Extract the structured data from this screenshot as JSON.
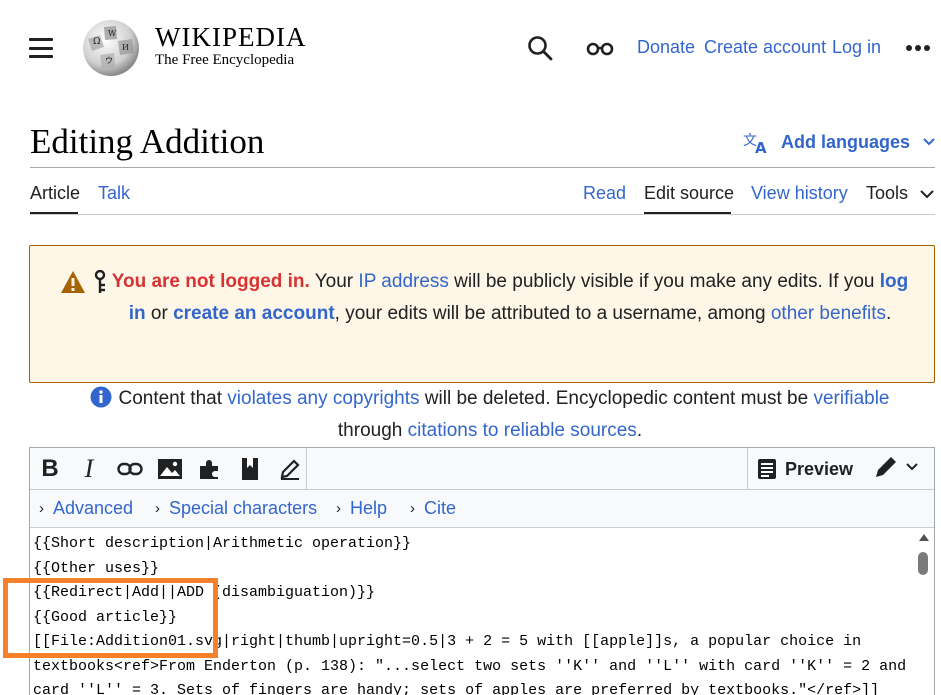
{
  "header": {
    "wordmark": "WIKIPEDIA",
    "tagline": "The Free Encyclopedia",
    "donate": "Donate",
    "create_account": "Create account",
    "log_in": "Log in",
    "icons": [
      "menu-icon",
      "wikipedia-globe-logo",
      "search-icon",
      "glasses-icon",
      "more-icon"
    ]
  },
  "page": {
    "title": "Editing Addition",
    "add_languages": "Add languages"
  },
  "tabs": {
    "left": [
      {
        "label": "Article",
        "active": true
      },
      {
        "label": "Talk",
        "active": false
      }
    ],
    "right": [
      {
        "label": "Read",
        "active": false
      },
      {
        "label": "Edit source",
        "active": true
      },
      {
        "label": "View history",
        "active": false
      },
      {
        "label": "Tools",
        "active": false
      }
    ]
  },
  "warning": {
    "not_logged_in": "You are not logged in.",
    "t1": " Your ",
    "ip_address": "IP address",
    "t2": " will be publicly visible if you make any edits. If you ",
    "log_in": "log in",
    "t3": " or ",
    "create_account": "create an account",
    "t4": ", your edits will be attributed to a username, among ",
    "other_benefits": "other benefits",
    "t5": "."
  },
  "copyright": {
    "t1": "Content that ",
    "violates": "violates any copyrights",
    "t2": " will be deleted. Encyclopedic content must be ",
    "verifiable": "verifiable",
    "t3": " through ",
    "citations": "citations to reliable sources",
    "t4": "."
  },
  "editor": {
    "toolbar": {
      "tools": [
        "bold-icon",
        "italic-icon",
        "link-icon",
        "image-icon",
        "puzzle-icon",
        "bookmark-icon",
        "pencil-icon"
      ],
      "preview": "Preview"
    },
    "menus": [
      "Advanced",
      "Special characters",
      "Help",
      "Cite"
    ],
    "lines": [
      "{{Short description|Arithmetic operation}}",
      "{{Other uses}}",
      "{{Redirect|Add||ADD (disambiguation)}}",
      "{{Good article}}",
      "[[File:Addition01.svg|right|thumb|upright=0.5|3 + 2 = 5 with [[apple]]s, a popular choice in",
      "textbooks<ref>From Enderton (p. 138): \"...select two sets ''K'' and ''L'' with card ''K'' = 2 and",
      "card ''L'' = 3. Sets of fingers are handy; sets of apples are preferred by textbooks.\"</ref>]]"
    ]
  },
  "colors": {
    "link": "#3366cc",
    "warning_bg": "#fef6e7",
    "warning_border": "#a66200",
    "warning_red": "#d73333",
    "highlight": "#f7812a"
  }
}
